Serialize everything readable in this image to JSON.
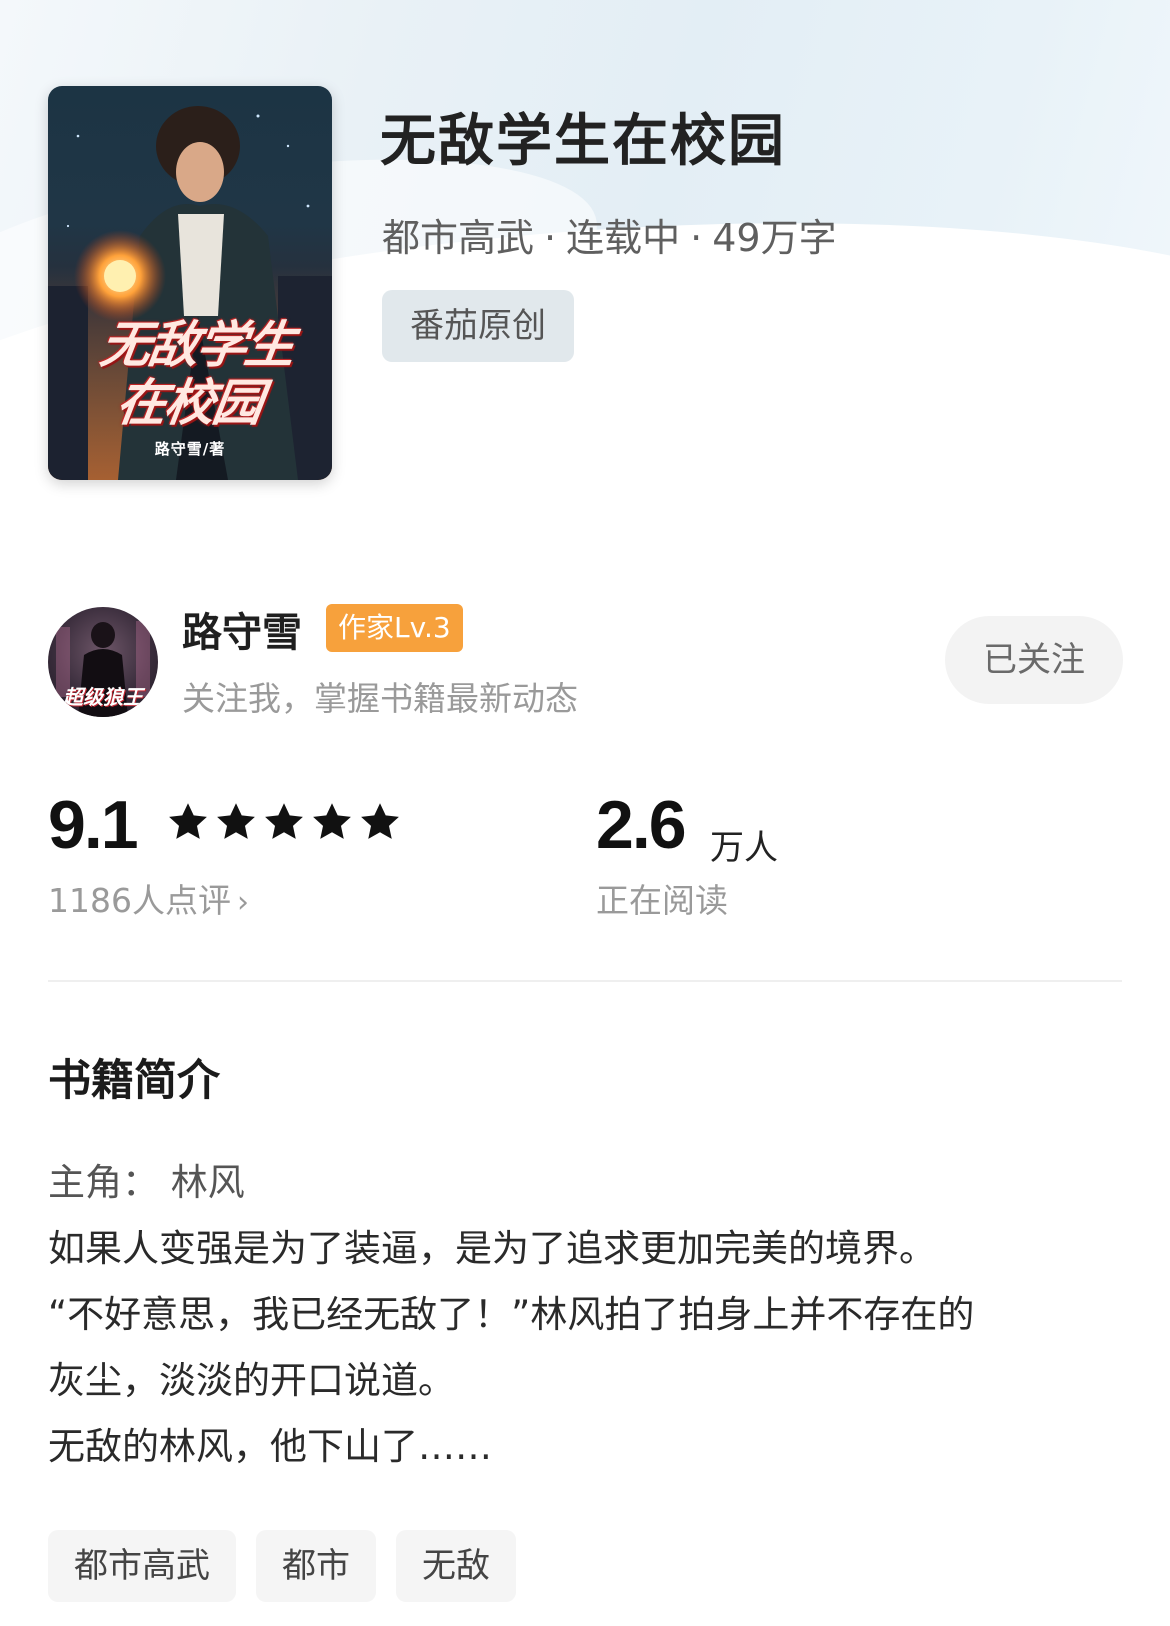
{
  "book": {
    "title": "无敌学生在校园",
    "genre": "都市高武",
    "status": "连载中",
    "word_count": "49万字",
    "meta_separator": "·",
    "origin_tag": "番茄原创",
    "cover": {
      "title_line1": "无敌学生",
      "title_line2": "在校园",
      "author_credit": "路守雪/著"
    }
  },
  "author": {
    "name": "路守雪",
    "level": "作家Lv.3",
    "description": "关注我，掌握书籍最新动态",
    "follow_label": "已关注",
    "avatar_text": "超级狼王"
  },
  "stats": {
    "rating": "9.1",
    "stars": 5,
    "review_count": "1186人点评",
    "review_chevron": "›",
    "readers": "2.6",
    "readers_unit": "万人",
    "readers_label": "正在阅读"
  },
  "intro": {
    "heading": "书籍简介",
    "lines": [
      "主角：  林风",
      "如果人变强是为了装逼，是为了追求更加完美的境界。",
      "“不好意思，我已经无敌了！”林风拍了拍身上并不存在的",
      "灰尘，淡淡的开口说道。",
      "无敌的林风，他下山了……"
    ]
  },
  "tags": [
    "都市高武",
    "都市",
    "无敌"
  ],
  "colors": {
    "accent_level": "#f7a13c",
    "follow_bg": "#f3f3f3",
    "tag_bg": "#f5f5f5"
  }
}
